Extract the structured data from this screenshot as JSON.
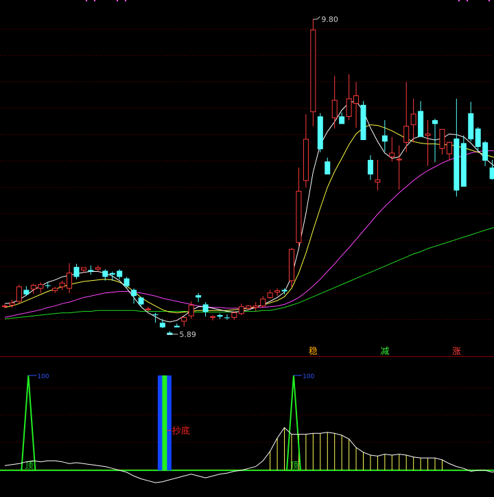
{
  "chart_data": [
    {
      "type": "candlestick",
      "price_range": [
        5.6,
        10.0
      ],
      "high_label": "9.80",
      "low_label": "5.89",
      "grid": true,
      "colors": {
        "up": "#ff3b3b",
        "down": "#54ffff",
        "ma5": "#ffffff",
        "ma10": "#ffff44",
        "ma20": "#ff44ff",
        "ma60": "#22dd22",
        "grid": "#7a0000",
        "marker": "#ff55ff"
      },
      "candles": [
        [
          6.07,
          6.09,
          6.04,
          6.07
        ],
        [
          6.08,
          6.15,
          6.05,
          6.11
        ],
        [
          6.13,
          6.35,
          6.1,
          6.32
        ],
        [
          6.28,
          6.33,
          6.2,
          6.22
        ],
        [
          6.29,
          6.36,
          6.23,
          6.34
        ],
        [
          6.3,
          6.38,
          6.24,
          6.35
        ],
        [
          6.34,
          6.38,
          6.3,
          6.33
        ],
        [
          6.27,
          6.32,
          6.24,
          6.3
        ],
        [
          6.32,
          6.4,
          6.28,
          6.37
        ],
        [
          6.3,
          6.63,
          6.24,
          6.5
        ],
        [
          6.58,
          6.62,
          6.42,
          6.45
        ],
        [
          6.54,
          6.57,
          6.5,
          6.57
        ],
        [
          6.54,
          6.6,
          6.48,
          6.52
        ],
        [
          6.55,
          6.6,
          6.52,
          6.57
        ],
        [
          6.53,
          6.55,
          6.4,
          6.45
        ],
        [
          6.5,
          6.52,
          6.4,
          6.48
        ],
        [
          6.53,
          6.55,
          6.42,
          6.45
        ],
        [
          6.43,
          6.45,
          6.31,
          6.33
        ],
        [
          6.28,
          6.3,
          6.1,
          6.2
        ],
        [
          6.18,
          6.19,
          6.06,
          6.09
        ],
        [
          6.03,
          6.06,
          6.0,
          6.03
        ],
        [
          5.96,
          5.98,
          5.85,
          5.95
        ],
        [
          5.85,
          5.9,
          5.78,
          5.79
        ],
        [
          5.72,
          5.74,
          5.7,
          5.69
        ],
        [
          5.81,
          5.84,
          5.8,
          5.79
        ],
        [
          5.87,
          5.93,
          5.8,
          5.92
        ],
        [
          5.94,
          6.13,
          5.9,
          6.08
        ],
        [
          6.21,
          6.24,
          6.12,
          6.18
        ],
        [
          6.09,
          6.12,
          5.93,
          5.99
        ],
        [
          5.92,
          5.95,
          5.88,
          5.93
        ],
        [
          5.95,
          5.97,
          5.9,
          5.93
        ],
        [
          5.92,
          5.96,
          5.89,
          5.91
        ],
        [
          5.92,
          6.0,
          5.89,
          5.98
        ],
        [
          5.97,
          6.1,
          5.95,
          6.06
        ],
        [
          6.04,
          6.08,
          6.02,
          6.07
        ],
        [
          6.05,
          6.12,
          6.0,
          6.07
        ],
        [
          6.07,
          6.2,
          6.05,
          6.16
        ],
        [
          6.18,
          6.28,
          6.16,
          6.24
        ],
        [
          6.25,
          6.3,
          6.2,
          6.27
        ],
        [
          6.28,
          6.3,
          6.22,
          6.26
        ],
        [
          6.4,
          6.83,
          6.32,
          6.81
        ],
        [
          6.9,
          7.88,
          6.85,
          7.57
        ],
        [
          7.71,
          8.58,
          7.62,
          8.25
        ],
        [
          8.61,
          9.82,
          8.42,
          9.68
        ],
        [
          8.55,
          8.59,
          8.08,
          8.12
        ],
        [
          7.96,
          8.01,
          7.83,
          7.79
        ],
        [
          8.53,
          9.08,
          8.39,
          8.76
        ],
        [
          8.55,
          8.6,
          8.51,
          8.45
        ],
        [
          8.55,
          9.1,
          8.5,
          8.78
        ],
        [
          8.72,
          9.0,
          8.4,
          8.82
        ],
        [
          8.7,
          8.75,
          8.25,
          8.24
        ],
        [
          7.98,
          8.04,
          7.72,
          7.79
        ],
        [
          7.69,
          7.98,
          7.58,
          7.72
        ],
        [
          8.3,
          8.5,
          8.09,
          8.22
        ],
        [
          8.02,
          8.28,
          7.96,
          8.07
        ],
        [
          7.98,
          8.17,
          7.59,
          7.99
        ],
        [
          8.21,
          9.0,
          8.08,
          8.42
        ],
        [
          8.44,
          8.78,
          8.21,
          8.58
        ],
        [
          8.62,
          8.75,
          8.43,
          8.28
        ],
        [
          8.3,
          8.5,
          7.9,
          8.32
        ],
        [
          8.5,
          8.52,
          7.95,
          8.45
        ],
        [
          8.13,
          8.35,
          8.05,
          8.38
        ],
        [
          8.06,
          8.22,
          7.98,
          8.21
        ],
        [
          8.26,
          8.78,
          7.5,
          7.58
        ],
        [
          8.2,
          8.3,
          8.0,
          7.63
        ],
        [
          8.59,
          8.74,
          8.22,
          8.25
        ],
        [
          8.39,
          8.41,
          8.09,
          8.15
        ],
        [
          8.21,
          8.23,
          7.9,
          7.97
        ],
        [
          7.88,
          7.98,
          7.72,
          7.73
        ],
        [
          7.83,
          7.92,
          7.6,
          7.7
        ]
      ],
      "ma5": [
        6.1,
        6.11,
        6.15,
        6.21,
        6.28,
        6.33,
        6.38,
        6.41,
        6.45,
        6.47,
        6.49,
        6.51,
        6.52,
        6.52,
        6.5,
        6.46,
        6.4,
        6.3,
        6.18,
        6.06,
        5.98,
        5.93,
        5.88,
        5.86,
        5.88,
        5.94,
        6.01,
        6.06,
        6.06,
        6.04,
        6.02,
        6.0,
        5.99,
        6.0,
        6.02,
        6.05,
        6.09,
        6.13,
        6.18,
        6.25,
        6.45,
        6.82,
        7.28,
        7.82,
        8.18,
        8.35,
        8.48,
        8.63,
        8.73,
        8.75,
        8.62,
        8.4,
        8.22,
        8.07,
        8.0,
        8.02,
        8.16,
        8.26,
        8.29,
        8.26,
        8.24,
        8.26,
        8.32,
        8.31,
        8.28,
        8.2,
        8.1,
        8.0,
        7.92,
        7.85
      ],
      "ma10": [
        6.05,
        6.07,
        6.1,
        6.14,
        6.18,
        6.22,
        6.26,
        6.29,
        6.32,
        6.35,
        6.37,
        6.39,
        6.4,
        6.41,
        6.42,
        6.41,
        6.38,
        6.33,
        6.26,
        6.18,
        6.12,
        6.07,
        6.02,
        5.99,
        5.98,
        5.99,
        6.0,
        6.01,
        6.01,
        6.01,
        6.01,
        6.01,
        6.02,
        6.03,
        6.04,
        6.06,
        6.08,
        6.11,
        6.14,
        6.19,
        6.3,
        6.5,
        6.76,
        7.06,
        7.35,
        7.62,
        7.83,
        8.0,
        8.18,
        8.32,
        8.4,
        8.44,
        8.43,
        8.4,
        8.36,
        8.31,
        8.26,
        8.22,
        8.2,
        8.19,
        8.19,
        8.18,
        8.18,
        8.16,
        8.14,
        8.11,
        8.08,
        8.05,
        8.02,
        7.99
      ],
      "ma20": [
        5.92,
        5.94,
        5.96,
        5.98,
        6.0,
        6.02,
        6.05,
        6.07,
        6.1,
        6.12,
        6.15,
        6.18,
        6.2,
        6.22,
        6.24,
        6.25,
        6.26,
        6.26,
        6.25,
        6.24,
        6.22,
        6.2,
        6.17,
        6.15,
        6.13,
        6.11,
        6.09,
        6.07,
        6.06,
        6.05,
        6.05,
        6.04,
        6.04,
        6.04,
        6.04,
        6.05,
        6.05,
        6.06,
        6.07,
        6.09,
        6.13,
        6.18,
        6.25,
        6.33,
        6.42,
        6.52,
        6.62,
        6.73,
        6.83,
        6.94,
        7.05,
        7.16,
        7.27,
        7.37,
        7.46,
        7.55,
        7.63,
        7.71,
        7.78,
        7.84,
        7.89,
        7.94,
        7.98,
        8.01,
        8.04,
        8.07,
        8.09,
        8.1,
        8.1,
        8.1
      ],
      "ma60": [
        5.9,
        5.91,
        5.92,
        5.93,
        5.94,
        5.95,
        5.96,
        5.97,
        5.98,
        5.98,
        5.99,
        6.0,
        6.0,
        6.01,
        6.01,
        6.01,
        6.01,
        6.01,
        6.01,
        6.0,
        6.0,
        6.0,
        6.0,
        6.0,
        6.0,
        6.0,
        5.99,
        5.99,
        5.99,
        5.99,
        5.99,
        5.99,
        5.99,
        6.0,
        6.0,
        6.0,
        6.01,
        6.01,
        6.03,
        6.05,
        6.08,
        6.11,
        6.15,
        6.19,
        6.23,
        6.27,
        6.31,
        6.35,
        6.39,
        6.43,
        6.47,
        6.51,
        6.55,
        6.59,
        6.63,
        6.67,
        6.71,
        6.75,
        6.78,
        6.82,
        6.85,
        6.88,
        6.91,
        6.94,
        6.97,
        7.0,
        7.03,
        7.06,
        7.09,
        7.12
      ],
      "signal_markers": [
        {
          "text": "稳",
          "index": 43,
          "color": "#ffaa00"
        },
        {
          "text": "减",
          "index": 53,
          "color": "#33ee33"
        },
        {
          "text": "涨",
          "index": 63,
          "color": "#ff3b3b"
        }
      ]
    },
    {
      "type": "indicator",
      "range": [
        -5,
        105
      ],
      "zero_line": 0,
      "line": [
        5,
        6,
        7,
        9,
        10,
        9,
        10,
        10,
        9,
        7,
        8,
        7,
        6,
        5,
        4,
        2,
        0,
        -2,
        -6,
        -9,
        -11,
        -13,
        -12,
        -10,
        -8,
        -6,
        -4,
        -6,
        -8,
        -6,
        -4,
        -3,
        -1,
        0,
        2,
        4,
        10,
        20,
        34,
        45,
        38,
        38,
        38,
        39,
        39,
        40,
        39,
        37,
        33,
        24,
        19,
        16,
        15,
        17,
        16,
        17,
        16,
        14,
        13,
        13,
        13,
        11,
        7,
        4,
        2,
        -1,
        0,
        0,
        -2,
        0,
        -3,
        -4,
        -5
      ],
      "buy_signals": [
        22
      ],
      "buy_label": "抄底",
      "top_signals": [
        3,
        40
      ],
      "top_label": "顶",
      "peak_value_label": "100",
      "yellow_bars": [
        37,
        38,
        39,
        40,
        41,
        42,
        43,
        44,
        45,
        46,
        47,
        48,
        49,
        50,
        51,
        52,
        53,
        54,
        55,
        56,
        57,
        58,
        59,
        60,
        61
      ],
      "colors": {
        "line": "#ffffff",
        "zero": "#22ee22",
        "top": "#22ee22",
        "buy": "#1144ff",
        "buy_inner": "#22ee22",
        "buy_label": "#ff2222",
        "bars": "#ffff55",
        "peak_label": "#3355ff",
        "grid": "#7a0000"
      }
    }
  ]
}
